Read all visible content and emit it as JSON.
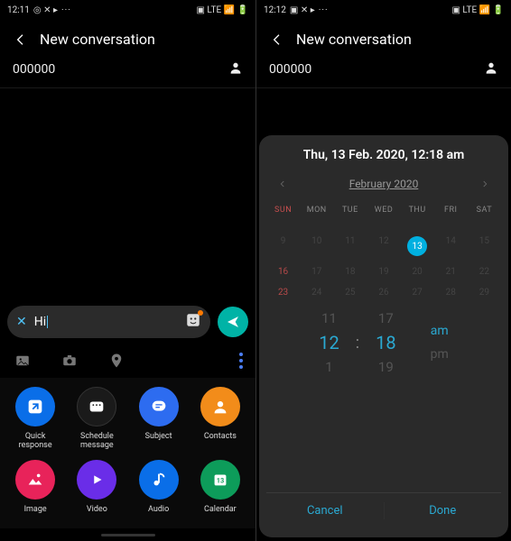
{
  "left": {
    "status": {
      "time": "12:11",
      "icons_left": "◎ ✕ ▸",
      "dots": "···",
      "icons_right": "▣ LTE 📶 🔋"
    },
    "header": {
      "title": "New conversation"
    },
    "recipient": "000000",
    "compose": {
      "text": "Hi"
    },
    "strip": {
      "gallery": "gallery",
      "camera": "camera",
      "location": "location",
      "more": "more"
    },
    "grid": [
      {
        "label": "Quick response",
        "color": "#0a6ee8"
      },
      {
        "label": "Schedule message",
        "color": "#1a1a1a"
      },
      {
        "label": "Subject",
        "color": "#2d6cf0"
      },
      {
        "label": "Contacts",
        "color": "#f28c1a"
      },
      {
        "label": "Image",
        "color": "#e8235a"
      },
      {
        "label": "Video",
        "color": "#6a2de8"
      },
      {
        "label": "Audio",
        "color": "#0a6ee8"
      },
      {
        "label": "Calendar",
        "color": "#0d9c5a"
      }
    ],
    "calendar_day": "13"
  },
  "right": {
    "status": {
      "time": "12:12",
      "icons_left": "▣ ✕ ▸",
      "dots": "···",
      "icons_right": "▣ LTE 📶 🔋"
    },
    "header": {
      "title": "New conversation"
    },
    "recipient": "000000",
    "schedule": {
      "title": "Thu, 13 Feb. 2020, 12:18 am",
      "month_label": "February 2020",
      "dow": [
        "SUN",
        "MON",
        "TUE",
        "WED",
        "THU",
        "FRI",
        "SAT"
      ],
      "weeks": [
        [
          "",
          "",
          "",
          "",
          "",
          "",
          ""
        ],
        [
          "9",
          "10",
          "11",
          "12",
          "13",
          "14",
          "15"
        ],
        [
          "16",
          "17",
          "18",
          "19",
          "20",
          "21",
          "22"
        ],
        [
          "23",
          "24",
          "25",
          "26",
          "27",
          "28",
          "29"
        ]
      ],
      "selected_day": "13",
      "time": {
        "h_prev": "11",
        "h": "12",
        "h_next": "1",
        "m_prev": "17",
        "m": "18",
        "m_next": "19",
        "am": "am",
        "pm": "pm",
        "colon": ":"
      },
      "cancel": "Cancel",
      "done": "Done"
    }
  }
}
